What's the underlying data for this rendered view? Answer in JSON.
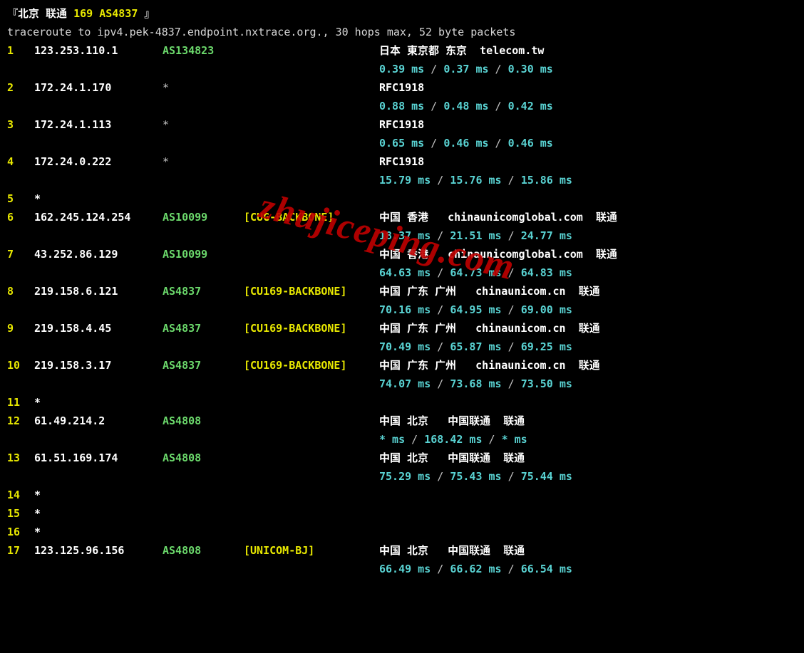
{
  "header": {
    "prefix": "『北京 联通",
    "asn_tag": "169 AS4837",
    "suffix": "』",
    "cmd": "traceroute to ipv4.pek-4837.endpoint.nxtrace.org., 30 hops max, 52 byte packets"
  },
  "watermark": "zhujiceping.com",
  "hops": [
    {
      "n": "1",
      "ip": "123.253.110.1",
      "asn": "AS134823",
      "tag": "",
      "loc": "日本 東京都 东京  telecom.tw",
      "rtt": [
        "0.39 ms",
        "0.37 ms",
        "0.30 ms"
      ]
    },
    {
      "n": "2",
      "ip": "172.24.1.170",
      "asn": "*",
      "tag": "",
      "loc": "RFC1918",
      "rtt": [
        "0.88 ms",
        "0.48 ms",
        "0.42 ms"
      ]
    },
    {
      "n": "3",
      "ip": "172.24.1.113",
      "asn": "*",
      "tag": "",
      "loc": "RFC1918",
      "rtt": [
        "0.65 ms",
        "0.46 ms",
        "0.46 ms"
      ]
    },
    {
      "n": "4",
      "ip": "172.24.0.222",
      "asn": "*",
      "tag": "",
      "loc": "RFC1918",
      "rtt": [
        "15.79 ms",
        "15.76 ms",
        "15.86 ms"
      ]
    },
    {
      "n": "5",
      "ip": "*",
      "asn": "",
      "tag": "",
      "loc": "",
      "rtt": []
    },
    {
      "n": "6",
      "ip": "162.245.124.254",
      "asn": "AS10099",
      "tag": "[CUG-BACKBONE]",
      "loc": "中国 香港   chinaunicomglobal.com  联通",
      "rtt": [
        "18.37 ms",
        "21.51 ms",
        "24.77 ms"
      ]
    },
    {
      "n": "7",
      "ip": "43.252.86.129",
      "asn": "AS10099",
      "tag": "",
      "loc": "中国 香港   chinaunicomglobal.com  联通",
      "rtt": [
        "64.63 ms",
        "64.73 ms",
        "64.83 ms"
      ]
    },
    {
      "n": "8",
      "ip": "219.158.6.121",
      "asn": "AS4837",
      "tag": "[CU169-BACKBONE]",
      "loc": "中国 广东 广州   chinaunicom.cn  联通",
      "rtt": [
        "70.16 ms",
        "64.95 ms",
        "69.00 ms"
      ]
    },
    {
      "n": "9",
      "ip": "219.158.4.45",
      "asn": "AS4837",
      "tag": "[CU169-BACKBONE]",
      "loc": "中国 广东 广州   chinaunicom.cn  联通",
      "rtt": [
        "70.49 ms",
        "65.87 ms",
        "69.25 ms"
      ]
    },
    {
      "n": "10",
      "ip": "219.158.3.17",
      "asn": "AS4837",
      "tag": "[CU169-BACKBONE]",
      "loc": "中国 广东 广州   chinaunicom.cn  联通",
      "rtt": [
        "74.07 ms",
        "73.68 ms",
        "73.50 ms"
      ]
    },
    {
      "n": "11",
      "ip": "*",
      "asn": "",
      "tag": "",
      "loc": "",
      "rtt": []
    },
    {
      "n": "12",
      "ip": "61.49.214.2",
      "asn": "AS4808",
      "tag": "",
      "loc": "中国 北京   中国联通  联通",
      "rtt": [
        "* ms",
        "168.42 ms",
        "* ms"
      ]
    },
    {
      "n": "13",
      "ip": "61.51.169.174",
      "asn": "AS4808",
      "tag": "",
      "loc": "中国 北京   中国联通  联通",
      "rtt": [
        "75.29 ms",
        "75.43 ms",
        "75.44 ms"
      ]
    },
    {
      "n": "14",
      "ip": "*",
      "asn": "",
      "tag": "",
      "loc": "",
      "rtt": []
    },
    {
      "n": "15",
      "ip": "*",
      "asn": "",
      "tag": "",
      "loc": "",
      "rtt": []
    },
    {
      "n": "16",
      "ip": "*",
      "asn": "",
      "tag": "",
      "loc": "",
      "rtt": []
    },
    {
      "n": "17",
      "ip": "123.125.96.156",
      "asn": "AS4808",
      "tag": "[UNICOM-BJ]",
      "loc": "中国 北京   中国联通  联通",
      "rtt": [
        "66.49 ms",
        "66.62 ms",
        "66.54 ms"
      ]
    }
  ]
}
